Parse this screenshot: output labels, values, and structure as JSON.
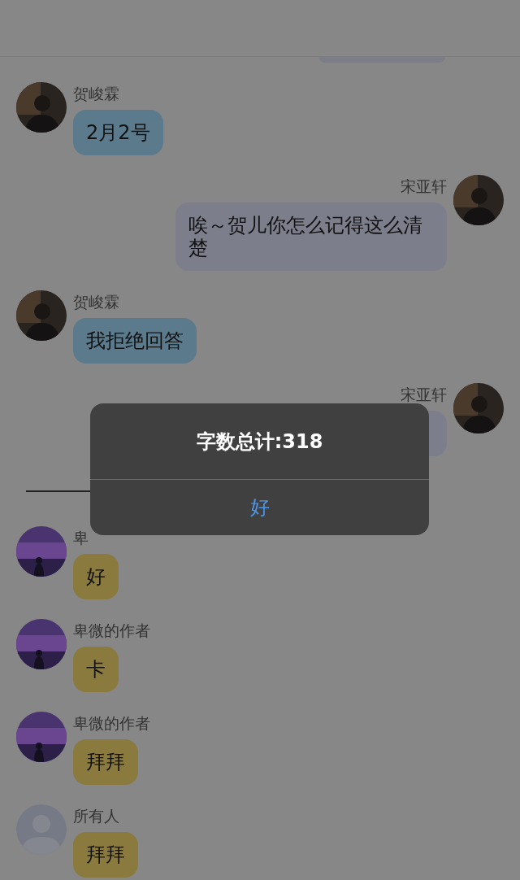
{
  "messages": [
    {
      "kind": "cut_bubble",
      "color": "#7c7d86"
    },
    {
      "kind": "message",
      "outgoing": false,
      "sender": "贺峻霖",
      "avatar": {
        "kind": "dark_photo"
      },
      "text": "2月2号",
      "color": "#5b7b8d"
    },
    {
      "kind": "message",
      "outgoing": true,
      "sender": "宋亚轩",
      "avatar": {
        "kind": "dark_photo"
      },
      "text": "唉～贺儿你怎么记得这么清楚",
      "color": "#7c7f8b"
    },
    {
      "kind": "message",
      "outgoing": false,
      "sender": "贺峻霖",
      "avatar": {
        "kind": "dark_photo"
      },
      "text": "我拒绝回答",
      "color": "#5b7b8d"
    },
    {
      "kind": "message",
      "outgoing": true,
      "sender": "宋亚轩",
      "avatar": {
        "kind": "dark_photo"
      },
      "color": "#7c7f8b"
    },
    {
      "kind": "divider"
    },
    {
      "kind": "message",
      "outgoing": false,
      "sender": "卑",
      "avatar": {
        "kind": "sky_photo"
      },
      "text": "好",
      "color": "#8a7a3e"
    },
    {
      "kind": "message",
      "outgoing": false,
      "sender": "卑微的作者",
      "avatar": {
        "kind": "sky_photo"
      },
      "text": "卡",
      "color": "#8a7a3e"
    },
    {
      "kind": "message",
      "outgoing": false,
      "sender": "卑微的作者",
      "avatar": {
        "kind": "sky_photo"
      },
      "text": "拜拜",
      "color": "#8a7a3e"
    },
    {
      "kind": "message",
      "outgoing": false,
      "sender": "所有人",
      "avatar": {
        "kind": "default"
      },
      "text": "拜拜",
      "color": "#8a7a3e"
    }
  ],
  "alert": {
    "title": "字数总计:318",
    "button": "好"
  }
}
